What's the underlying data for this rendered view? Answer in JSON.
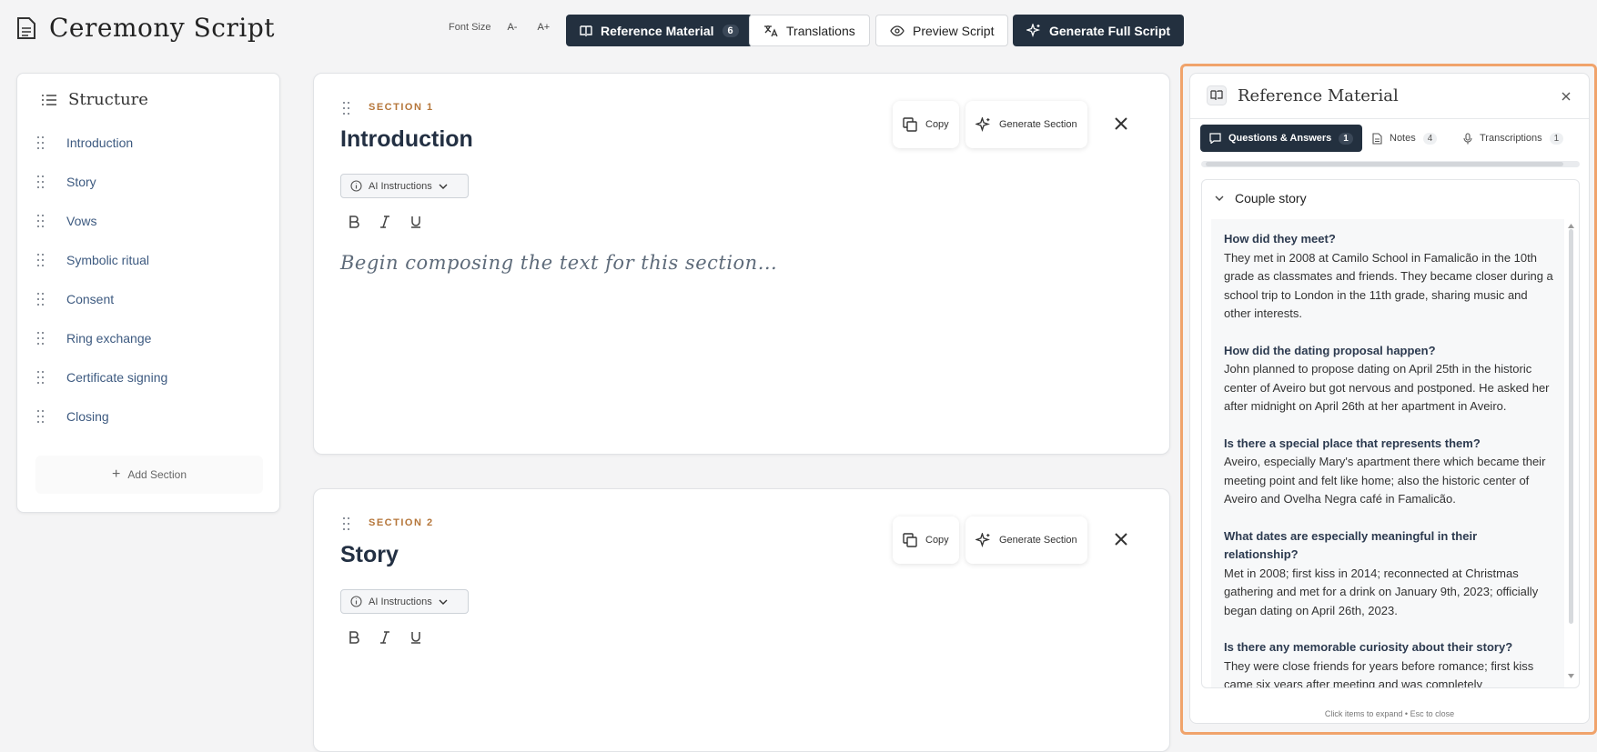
{
  "app": {
    "title": "Ceremony Script"
  },
  "toolbar": {
    "font_size_label": "Font Size",
    "decrease_label": "A-",
    "increase_label": "A+",
    "reference_label": "Reference Material",
    "reference_count": "6",
    "translations_label": "Translations",
    "preview_label": "Preview Script",
    "generate_label": "Generate Full Script"
  },
  "structure": {
    "title": "Structure",
    "items": [
      {
        "label": "Introduction"
      },
      {
        "label": "Story"
      },
      {
        "label": "Vows"
      },
      {
        "label": "Symbolic ritual"
      },
      {
        "label": "Consent"
      },
      {
        "label": "Ring exchange"
      },
      {
        "label": "Certificate signing"
      },
      {
        "label": "Closing"
      }
    ],
    "add_label": "Add Section"
  },
  "sections": [
    {
      "label": "SECTION 1",
      "title": "Introduction",
      "ai_label": "AI Instructions",
      "copy_label": "Copy",
      "generate_label": "Generate Section",
      "placeholder": "Begin composing the text for this section..."
    },
    {
      "label": "SECTION 2",
      "title": "Story",
      "ai_label": "AI Instructions",
      "copy_label": "Copy",
      "generate_label": "Generate Section",
      "placeholder": ""
    }
  ],
  "reference": {
    "title": "Reference Material",
    "tabs": [
      {
        "label": "Questions & Answers",
        "count": "1",
        "active": true
      },
      {
        "label": "Notes",
        "count": "4"
      },
      {
        "label": "Transcriptions",
        "count": "1"
      }
    ],
    "group_title": "Couple story",
    "qa": [
      {
        "q": "How did they meet?",
        "a": "They met in 2008 at Camilo School in Famalicão in the 10th grade as classmates and friends. They became closer during a school trip to London in the 11th grade, sharing music and other interests."
      },
      {
        "q": "How did the dating proposal happen?",
        "a": "John planned to propose dating on April 25th in the historic center of Aveiro but got nervous and postponed. He asked her after midnight on April 26th at her apartment in Aveiro."
      },
      {
        "q": "Is there a special place that represents them?",
        "a": "Aveiro, especially Mary's apartment there which became their meeting point and felt like home; also the historic center of Aveiro and Ovelha Negra café in Famalicão."
      },
      {
        "q": "What dates are especially meaningful in their relationship?",
        "a": "Met in 2008; first kiss in 2014; reconnected at Christmas gathering and met for a drink on January 9th, 2023; officially began dating on April 26th, 2023."
      },
      {
        "q": "Is there any memorable curiosity about their story?",
        "a": "They were close friends for years before romance; first kiss came six years after meeting and was completely"
      }
    ],
    "footer_hint": "Click items to expand • Esc to close"
  },
  "colors": {
    "dark": "#23303f",
    "accent": "#b5763a",
    "link": "#3d5a80",
    "outline": "#f0a36b"
  }
}
